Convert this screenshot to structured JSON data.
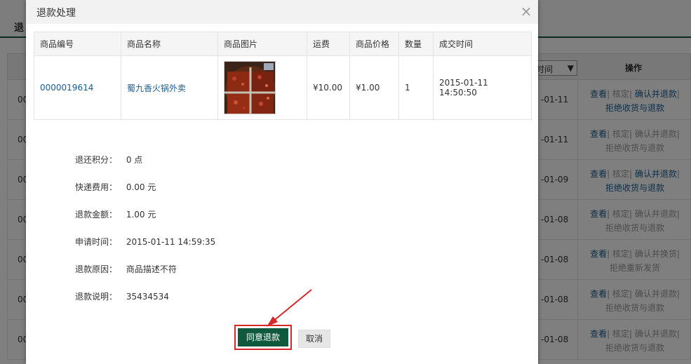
{
  "background": {
    "tab_label": "退",
    "date_header": "时间",
    "op_header": "操作",
    "rows": [
      {
        "left": "00",
        "date": "-01-11",
        "op1": "查看",
        "op2": "核定",
        "op3": "确认并退款",
        "op4": "拒绝收货与退款",
        "op3_active": true,
        "op4_active": true
      },
      {
        "left": "00",
        "date": "-01-11",
        "op1": "查看",
        "op2": "核定",
        "op3": "确认并退款",
        "op4": "拒绝收货与退款",
        "op3_active": false,
        "op4_active": false
      },
      {
        "left": "00",
        "date": "-01-09",
        "op1": "查看",
        "op2": "核定",
        "op3": "确认并退款",
        "op4": "拒绝收货与退款",
        "op3_active": true,
        "op4_active": true
      },
      {
        "left": "00",
        "date": "-01-08",
        "op1": "查看",
        "op2": "核定",
        "op3": "确认并退款",
        "op4": "拒绝收货与退款",
        "op3_active": false,
        "op4_active": false
      },
      {
        "left": "00",
        "date": "-01-08",
        "op1": "查看",
        "op2": "核定",
        "op3": "确认并换货",
        "op4": "拒绝重新发货",
        "op3_active": false,
        "op4_active": false
      },
      {
        "left": "00",
        "date": "-01-08",
        "op1": "查看",
        "op2": "核定",
        "op3": "确认并退款",
        "op4": "拒绝收货与退款",
        "op3_active": false,
        "op4_active": false
      },
      {
        "left": "00",
        "date": "-01-08",
        "op1": "查看",
        "op2": "核定",
        "op3": "确认并退款",
        "op4": "拒绝收货与退款",
        "op3_active": false,
        "op4_active": false
      }
    ]
  },
  "dialog": {
    "title": "退款处理",
    "close_symbol": "×",
    "table": {
      "headers": [
        "商品编号",
        "商品名称",
        "商品图片",
        "运费",
        "商品价格",
        "数量",
        "成交时间"
      ],
      "row": {
        "product_id": "0000019614",
        "product_name": "蜀九香火锅外卖",
        "shipping": "¥10.00",
        "price": "¥1.00",
        "quantity": "1",
        "deal_time": "2015-01-11 14:50:50"
      }
    },
    "info": [
      {
        "label": "退还积分：",
        "value": "0  点"
      },
      {
        "label": "快递费用：",
        "value": "0.00  元"
      },
      {
        "label": "退款金额：",
        "value": "1.00  元"
      },
      {
        "label": "申请时间：",
        "value": "2015-01-11 14:59:35"
      },
      {
        "label": "退款原因：",
        "value": "商品描述不符"
      },
      {
        "label": "退款说明：",
        "value": "35434534"
      }
    ],
    "agree_button": "同意退款",
    "cancel_button": "取消"
  },
  "colors": {
    "brand_green": "#0f5a3f",
    "link_blue": "#1b5c8f",
    "annotation_red": "#d62828"
  }
}
